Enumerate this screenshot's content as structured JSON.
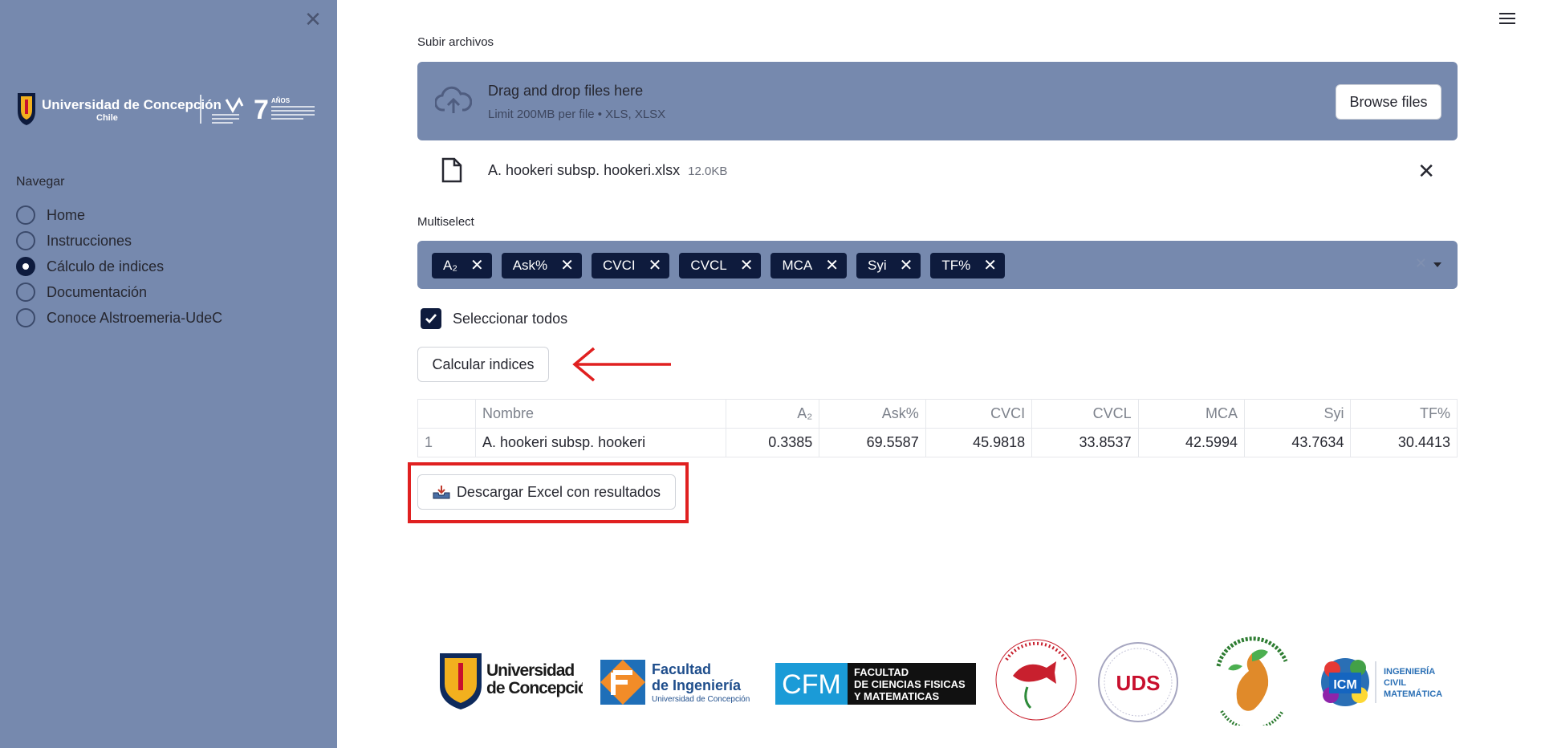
{
  "sidebar": {
    "logo": {
      "university": "Universidad de Concepción",
      "country": "Chile",
      "accreditation_years": "7",
      "accreditation_label": "AÑOS"
    },
    "nav_label": "Navegar",
    "items": [
      {
        "label": "Home",
        "selected": false
      },
      {
        "label": "Instrucciones",
        "selected": false
      },
      {
        "label": "Cálculo de indices",
        "selected": true
      },
      {
        "label": "Documentación",
        "selected": false
      },
      {
        "label": "Conoce Alstroemeria-UdeC",
        "selected": false
      }
    ]
  },
  "uploader": {
    "label": "Subir archivos",
    "drop_title": "Drag and drop files here",
    "drop_sub": "Limit 200MB per file • XLS, XLSX",
    "browse_label": "Browse files",
    "file": {
      "name": "A. hookeri subsp. hookeri.xlsx",
      "size": "12.0KB"
    }
  },
  "multiselect": {
    "label": "Multiselect",
    "tags": [
      "A₂",
      "Ask%",
      "CVCI",
      "CVCL",
      "MCA",
      "Syi",
      "TF%"
    ]
  },
  "select_all": {
    "label": "Seleccionar todos",
    "checked": true
  },
  "calc_button": "Calcular indices",
  "table": {
    "headers": [
      "",
      "Nombre",
      "A₂",
      "Ask%",
      "CVCI",
      "CVCL",
      "MCA",
      "Syi",
      "TF%"
    ],
    "rows": [
      [
        "1",
        "A. hookeri subsp. hookeri",
        "0.3385",
        "69.5587",
        "45.9818",
        "33.8537",
        "42.5994",
        "43.7634",
        "30.4413"
      ]
    ]
  },
  "download_button": "Descargar Excel con resultados",
  "footer_logos": {
    "udec_line1": "Universidad",
    "udec_line2": "de Concepción",
    "ing_line1": "Facultad",
    "ing_line2": "de Ingeniería",
    "ing_line3": "Universidad de Concepción",
    "cfm_abbr": "CFM",
    "cfm_line1": "FACULTAD",
    "cfm_line2": "DE CIENCIAS FISICAS",
    "cfm_line3": "Y MATEMATICAS",
    "uds": "UDS",
    "icm_abbr": "ICM",
    "icm_line1": "INGENIERÍA",
    "icm_line2": "CIVIL",
    "icm_line3": "MATEMÁTICA"
  },
  "colors": {
    "sidebar_bg": "#7689ae",
    "primary_dark": "#0e1b3d",
    "annotation_red": "#e02020"
  }
}
